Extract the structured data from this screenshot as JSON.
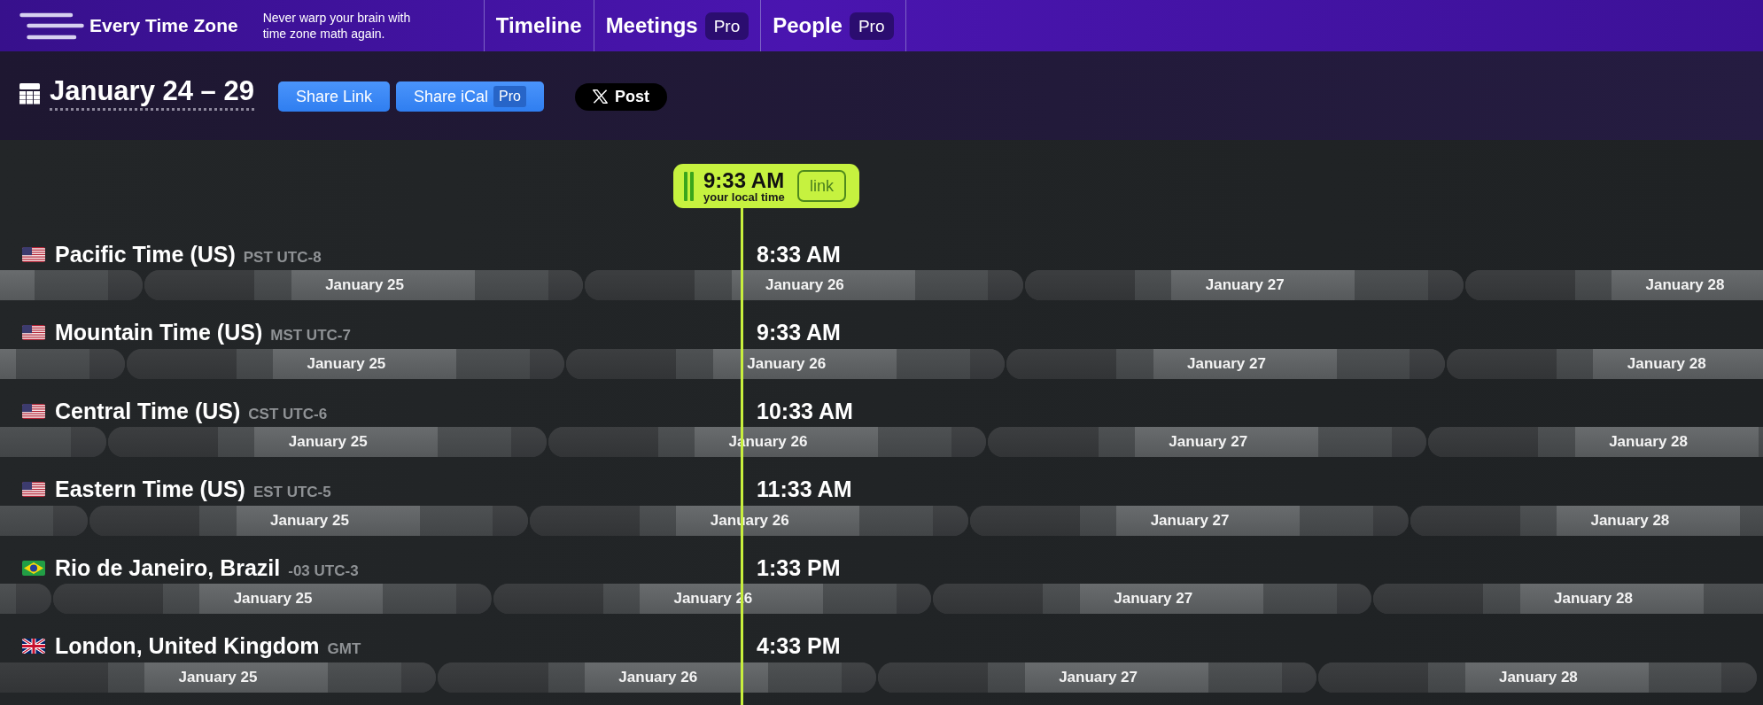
{
  "header": {
    "app_name": "Every Time Zone",
    "tagline": "Never warp your brain with time zone math again.",
    "nav": [
      {
        "label": "Timeline"
      },
      {
        "label": "Meetings",
        "badge": "Pro"
      },
      {
        "label": "People",
        "badge": "Pro"
      }
    ]
  },
  "toolbar": {
    "date_range": "January 24 – 29",
    "buttons": [
      {
        "kind": "primary",
        "label": "Share Link"
      },
      {
        "kind": "primary",
        "label": "Share iCal",
        "badge": "Pro"
      },
      {
        "kind": "social",
        "label": "Post"
      }
    ]
  },
  "marker": {
    "time": "9:33 AM",
    "caption": "your local time",
    "link": "link"
  },
  "zones": [
    {
      "flag": {
        "kind": "us"
      },
      "name": "Pacific Time (US)",
      "abbreviation": "PST UTC-8",
      "time": "8:33 AM",
      "days": [
        "January 25",
        "January 26",
        "January 27",
        "January 28"
      ]
    },
    {
      "flag": {
        "kind": "us"
      },
      "name": "Mountain Time (US)",
      "abbreviation": "MST UTC-7",
      "time": "9:33 AM",
      "days": [
        "January 25",
        "January 26",
        "January 27",
        "January 28"
      ]
    },
    {
      "flag": {
        "kind": "us"
      },
      "name": "Central Time (US)",
      "abbreviation": "CST UTC-6",
      "time": "10:33 AM",
      "days": [
        "January 25",
        "January 26",
        "January 27",
        "January 28"
      ]
    },
    {
      "flag": {
        "kind": "us"
      },
      "name": "Eastern Time (US)",
      "abbreviation": "EST UTC-5",
      "time": "11:33 AM",
      "days": [
        "January 25",
        "January 26",
        "January 27",
        "January 28"
      ]
    },
    {
      "flag": {
        "kind": "br"
      },
      "name": "Rio de Janeiro, Brazil",
      "abbreviation": "-03 UTC-3",
      "time": "1:33 PM",
      "days": [
        "January 25",
        "January 26",
        "January 27",
        "January 28"
      ]
    },
    {
      "flag": {
        "kind": "gb"
      },
      "name": "London, United Kingdom",
      "abbreviation": "GMT",
      "time": "4:33 PM",
      "days": [
        "January 25",
        "January 26",
        "January 27",
        "January 28"
      ]
    }
  ]
}
